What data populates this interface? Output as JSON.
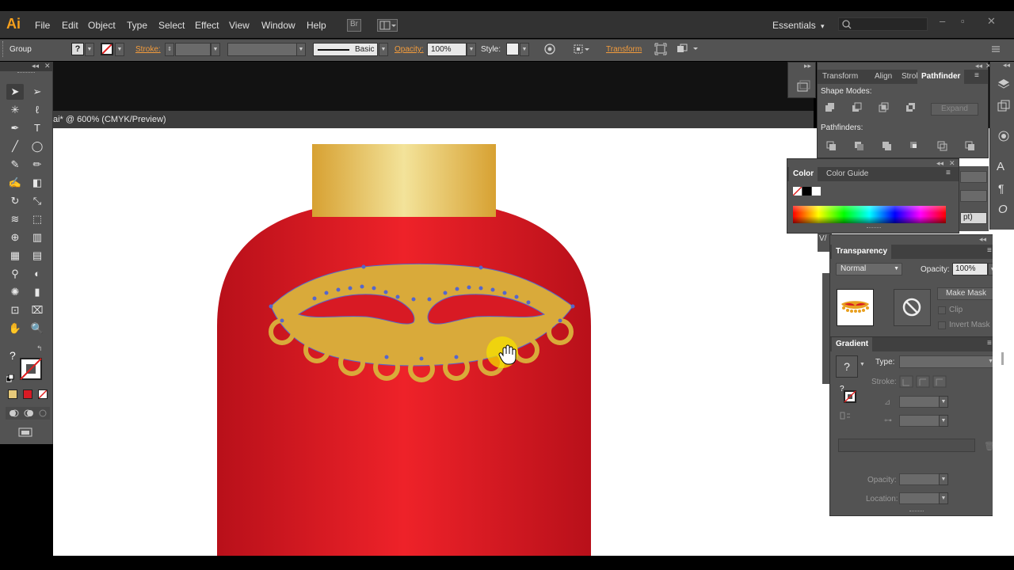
{
  "app": {
    "logo": "Ai",
    "brand_color": "#f7a01c"
  },
  "menubar": {
    "items": [
      "File",
      "Edit",
      "Object",
      "Type",
      "Select",
      "Effect",
      "View",
      "Window",
      "Help"
    ],
    "bridge_label": "Br",
    "workspace": "Essentials",
    "workspace_arrow": "▾",
    "window_controls": [
      "–",
      "▫",
      "✕"
    ]
  },
  "control_bar": {
    "selection_label": "Group",
    "stroke_label": "Stroke:",
    "brush_label": "Basic",
    "opacity_label": "Opacity:",
    "opacity_value": "100%",
    "style_label": "Style:",
    "transform_label": "Transform",
    "fill_glyph": "?",
    "stroke_glyph": "/"
  },
  "document": {
    "tab_label": "ai* @ 600% (CMYK/Preview)"
  },
  "tools": {
    "fill_glyph": "?",
    "icons": [
      "selection-tool-icon",
      "direct-selection-tool-icon",
      "magic-wand-tool-icon",
      "lasso-tool-icon",
      "pen-tool-icon",
      "type-tool-icon",
      "line-tool-icon",
      "ellipse-tool-icon",
      "paintbrush-tool-icon",
      "pencil-tool-icon",
      "blob-brush-tool-icon",
      "eraser-tool-icon",
      "rotate-tool-icon",
      "scale-tool-icon",
      "warp-tool-icon",
      "free-transform-tool-icon",
      "shape-builder-tool-icon",
      "graph-tool-icon",
      "mesh-tool-icon",
      "gradient-tool-icon",
      "eyedropper-tool-icon",
      "blend-tool-icon",
      "symbol-sprayer-tool-icon",
      "column-graph-tool-icon",
      "artboard-tool-icon",
      "slice-tool-icon",
      "hand-tool-icon",
      "zoom-tool-icon"
    ]
  },
  "pathfinder_panel": {
    "tabs": [
      "Transform",
      "Align",
      "Stroke",
      "Pathfinder"
    ],
    "active_tab": "Pathfinder",
    "shape_modes_label": "Shape Modes:",
    "expand_label": "Expand",
    "pathfinders_label": "Pathfinders:"
  },
  "color_panel": {
    "tabs": [
      "Color",
      "Color Guide"
    ],
    "active_tab": "Color"
  },
  "transparency_panel": {
    "title": "Transparency",
    "blend_mode": "Normal",
    "opacity_label": "Opacity:",
    "opacity_value": "100%",
    "make_mask_label": "Make Mask",
    "clip_label": "Clip",
    "invert_mask_label": "Invert Mask"
  },
  "gradient_panel": {
    "title": "Gradient",
    "type_label": "Type:",
    "stroke_label": "Stroke:",
    "opacity_label": "Opacity:",
    "location_label": "Location:",
    "fill_glyph": "?"
  },
  "side_strip": {
    "partial_text": "pt)",
    "partial_label": "V/"
  },
  "colors": {
    "bottle_red": "#e01e28",
    "gold": "#d9aa3a",
    "anchor_blue": "#5566cc",
    "ui_dark": "#535353",
    "accent_orange": "#f39c3c"
  }
}
